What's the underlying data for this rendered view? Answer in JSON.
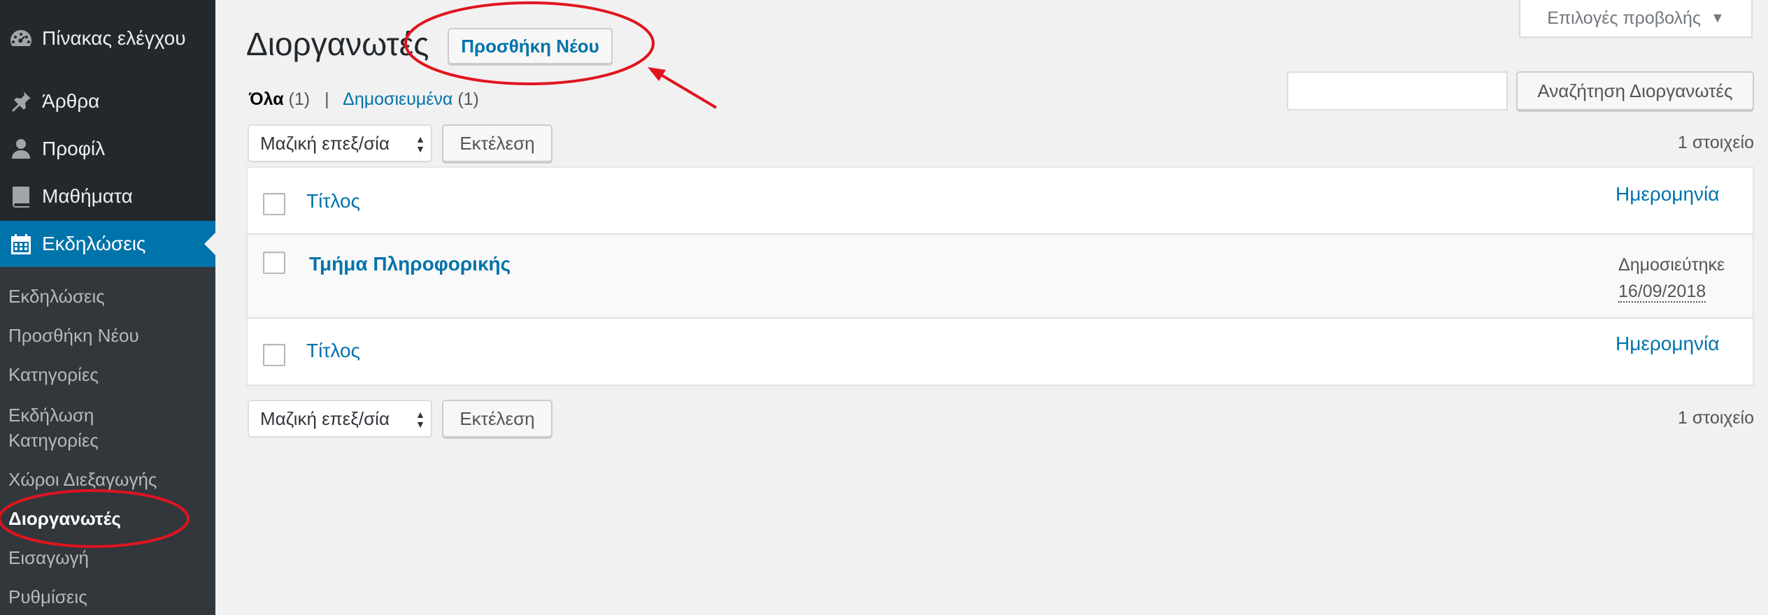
{
  "sidebar": {
    "top_items": [
      {
        "label": "Πίνακας ελέγχου",
        "icon": "dashboard-icon"
      },
      {
        "label": "Άρθρα",
        "icon": "pushpin-icon"
      },
      {
        "label": "Προφίλ",
        "icon": "user-icon"
      },
      {
        "label": "Μαθήματα",
        "icon": "book-icon"
      },
      {
        "label": "Εκδηλώσεις",
        "icon": "calendar-icon"
      }
    ],
    "submenu": [
      "Εκδηλώσεις",
      "Προσθήκη Νέου",
      "Κατηγορίες",
      "Εκδήλωση",
      "Κατηγορίες",
      "Χώροι Διεξαγωγής",
      "Διοργανωτές",
      "Εισαγωγή",
      "Ρυθμίσεις"
    ]
  },
  "header": {
    "title": "Διοργανωτές",
    "add_new_label": "Προσθήκη Νέου",
    "screen_options_label": "Επιλογές προβολής",
    "screen_options_arrow": "▼"
  },
  "filters": {
    "all_label": "Όλα",
    "all_count": "(1)",
    "separator": "|",
    "published_label": "Δημοσιευμένα",
    "published_count": "(1)"
  },
  "search": {
    "value": "",
    "button_label": "Αναζήτηση Διοργανωτές"
  },
  "bulk_actions": {
    "select_value": "Μαζική επεξ/σία",
    "apply_label": "Εκτέλεση",
    "items_count": "1 στοιχείο"
  },
  "table": {
    "columns": {
      "title": "Τίτλος",
      "date": "Ημερομηνία"
    },
    "rows": [
      {
        "title": "Τμήμα Πληροφορικής",
        "status": "Δημοσιεύτηκε",
        "date": "16/09/2018"
      }
    ]
  },
  "colors": {
    "sidebar_bg": "#23282d",
    "submenu_bg": "#32373c",
    "accent": "#0073aa",
    "annotation": "#e0141e"
  }
}
